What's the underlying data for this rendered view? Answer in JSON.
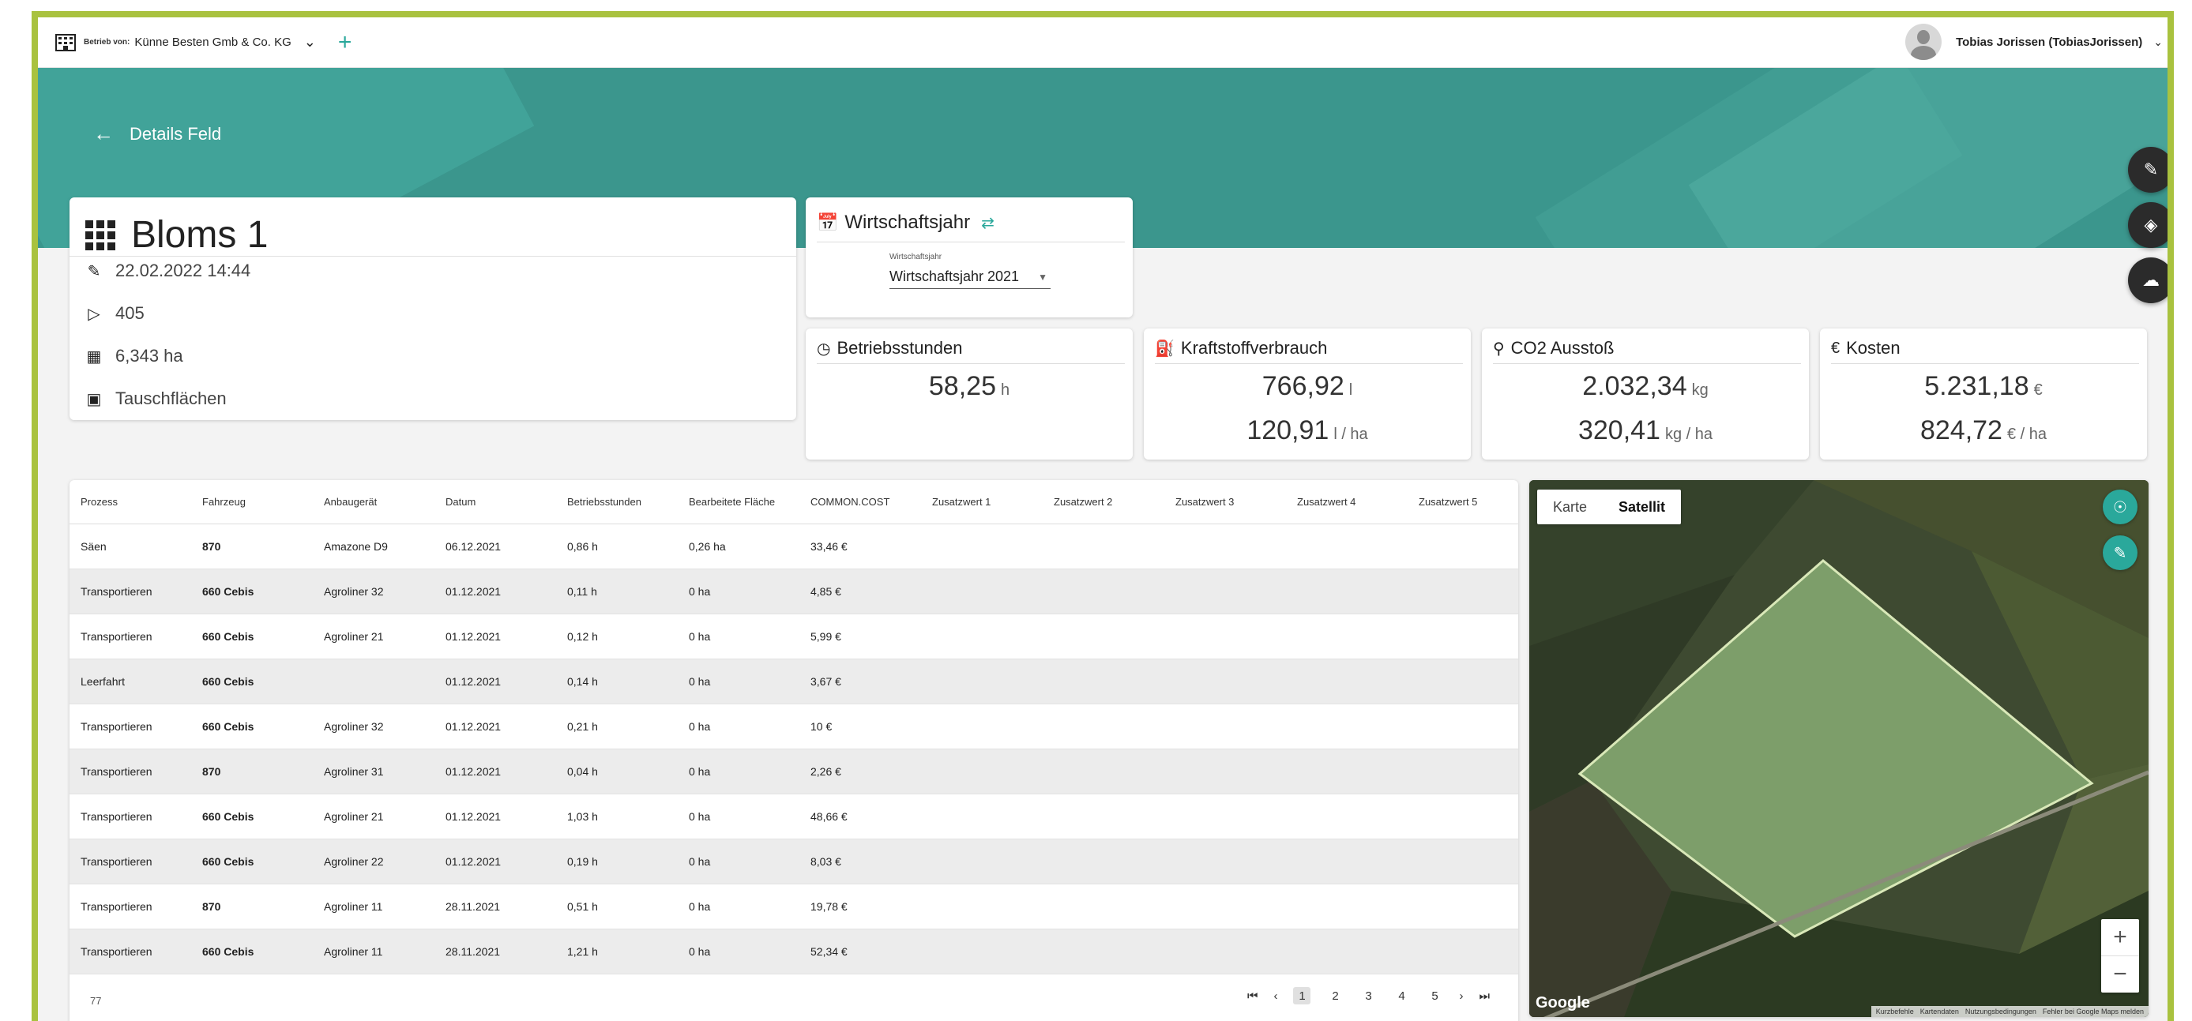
{
  "topbar": {
    "tenant_prefix": "Betrieb von:",
    "tenant_name": "Künne Besten Gmb & Co. KG",
    "user_name": "Tobias Jorissen (TobiasJorissen)"
  },
  "header": {
    "back_label": "Details Feld"
  },
  "field": {
    "name": "Bloms 1",
    "edited": "22.02.2022 14:44",
    "tag": "405",
    "area": "6,343 ha",
    "exchange": "Tauschflächen"
  },
  "fiscal_year": {
    "title": "Wirtschaftsjahr",
    "select_label": "Wirtschaftsjahr",
    "select_value": "Wirtschaftsjahr 2021"
  },
  "metrics": {
    "hours": {
      "title": "Betriebsstunden",
      "value": "58,25",
      "unit": "h"
    },
    "fuel": {
      "title": "Kraftstoffverbrauch",
      "value": "766,92",
      "unit": "l",
      "value2": "120,91",
      "unit2": "l / ha"
    },
    "co2": {
      "title": "CO2 Ausstoß",
      "value": "2.032,34",
      "unit": "kg",
      "value2": "320,41",
      "unit2": "kg / ha"
    },
    "cost": {
      "title": "Kosten",
      "value": "5.231,18",
      "unit": "€",
      "value2": "824,72",
      "unit2": "€ / ha"
    }
  },
  "table": {
    "headers": [
      "Prozess",
      "Fahrzeug",
      "Anbaugerät",
      "Datum",
      "Betriebsstunden",
      "Bearbeitete Fläche",
      "COMMON.COST",
      "Zusatzwert 1",
      "Zusatzwert 2",
      "Zusatzwert 3",
      "Zusatzwert 4",
      "Zusatzwert 5"
    ],
    "rows": [
      [
        "Säen",
        "870",
        "Amazone D9",
        "06.12.2021",
        "0,86 h",
        "0,26 ha",
        "33,46 €"
      ],
      [
        "Transportieren",
        "660 Cebis",
        "Agroliner 32",
        "01.12.2021",
        "0,11 h",
        "0 ha",
        "4,85 €"
      ],
      [
        "Transportieren",
        "660 Cebis",
        "Agroliner 21",
        "01.12.2021",
        "0,12 h",
        "0 ha",
        "5,99 €"
      ],
      [
        "Leerfahrt",
        "660 Cebis",
        "",
        "01.12.2021",
        "0,14 h",
        "0 ha",
        "3,67 €"
      ],
      [
        "Transportieren",
        "660 Cebis",
        "Agroliner 32",
        "01.12.2021",
        "0,21 h",
        "0 ha",
        "10 €"
      ],
      [
        "Transportieren",
        "870",
        "Agroliner 31",
        "01.12.2021",
        "0,04 h",
        "0 ha",
        "2,26 €"
      ],
      [
        "Transportieren",
        "660 Cebis",
        "Agroliner 21",
        "01.12.2021",
        "1,03 h",
        "0 ha",
        "48,66 €"
      ],
      [
        "Transportieren",
        "660 Cebis",
        "Agroliner 22",
        "01.12.2021",
        "0,19 h",
        "0 ha",
        "8,03 €"
      ],
      [
        "Transportieren",
        "870",
        "Agroliner 11",
        "28.11.2021",
        "0,51 h",
        "0 ha",
        "19,78 €"
      ],
      [
        "Transportieren",
        "660 Cebis",
        "Agroliner 11",
        "28.11.2021",
        "1,21 h",
        "0 ha",
        "52,34 €"
      ]
    ],
    "total_count": "77",
    "pages": [
      "1",
      "2",
      "3",
      "4",
      "5"
    ],
    "current_page": "1"
  },
  "map": {
    "tab_map": "Karte",
    "tab_satellite": "Satellit",
    "active_tab": "Satellit",
    "logo": "Google",
    "footer": [
      "Kurzbefehle",
      "Kartendaten",
      "Nutzungsbedingungen",
      "Fehler bei Google Maps melden"
    ]
  },
  "colors": {
    "accent": "#2aa89b",
    "hero": "#3b968d",
    "frame": "#a9c23f"
  }
}
